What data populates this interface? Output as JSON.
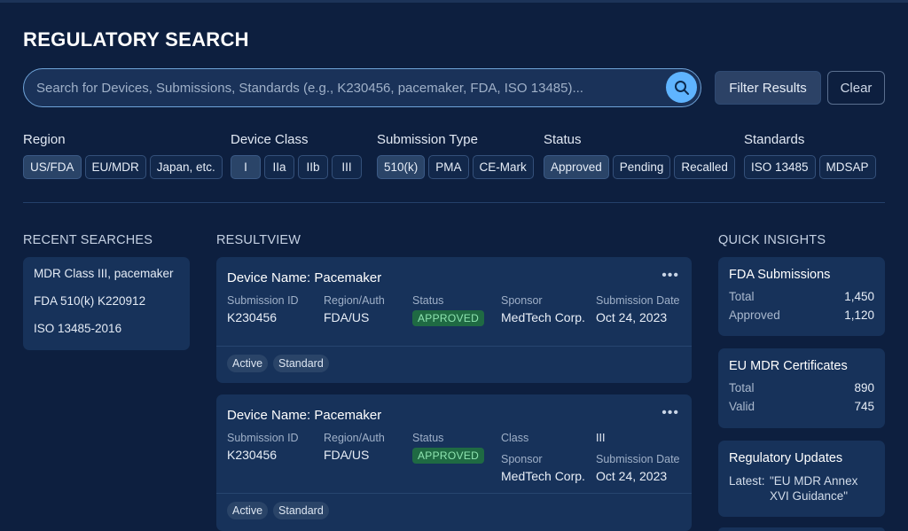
{
  "page_title": "REGULATORY SEARCH",
  "search": {
    "placeholder": "Search for Devices, Submissions, Standards (e.g., K230456, pacemaker, FDA, ISO 13485)..."
  },
  "buttons": {
    "filter": "Filter Results",
    "clear": "Clear"
  },
  "filters": {
    "region": {
      "label": "Region",
      "options": [
        "US/FDA",
        "EU/MDR",
        "Japan, etc."
      ]
    },
    "device_class": {
      "label": "Device Class",
      "options": [
        "I",
        "IIa",
        "IIb",
        "III"
      ]
    },
    "submission_type": {
      "label": "Submission Type",
      "options": [
        "510(k)",
        "PMA",
        "CE-Mark"
      ]
    },
    "status": {
      "label": "Status",
      "options": [
        "Approved",
        "Pending",
        "Recalled"
      ]
    },
    "standards": {
      "label": "Standards",
      "options": [
        "ISO 13485",
        "MDSAP"
      ]
    }
  },
  "recent": {
    "title": "RECENT SEARCHES",
    "items": [
      "MDR Class III, pacemaker",
      "FDA 510(k) K220912",
      "ISO 13485-2016"
    ]
  },
  "results": {
    "title": "RESULTVIEW",
    "cards": [
      {
        "name": "Device Name: Pacemaker",
        "submission_id_label": "Submission ID",
        "submission_id": "K230456",
        "region_label": "Region/Auth",
        "region": "FDA/US",
        "status_label": "Status",
        "status": "APPROVED",
        "sponsor_label": "Sponsor",
        "sponsor": "MedTech Corp.",
        "date_label": "Submission Date",
        "date": "Oct 24, 2023",
        "tags": [
          "Active",
          "Standard"
        ]
      },
      {
        "name": "Device Name: Pacemaker",
        "submission_id_label": "Submission ID",
        "submission_id": "K230456",
        "region_label": "Region/Auth",
        "region": "FDA/US",
        "status_label": "Status",
        "status": "APPROVED",
        "class_label": "Class",
        "class": "III",
        "sponsor_label": "Sponsor",
        "sponsor": "MedTech Corp.",
        "date_label": "Submission Date",
        "date": "Oct 24, 2023",
        "tags": [
          "Active",
          "Standard"
        ]
      }
    ]
  },
  "insights": {
    "title": "QUICK INSIGHTS",
    "fda": {
      "title": "FDA Submissions",
      "total_label": "Total",
      "total": "1,450",
      "approved_label": "Approved",
      "approved": "1,120"
    },
    "mdr": {
      "title": "EU MDR Certificates",
      "total_label": "Total",
      "total": "890",
      "valid_label": "Valid",
      "valid": "745"
    },
    "updates": {
      "title": "Regulatory Updates",
      "latest_label": "Latest:",
      "latest": "\"EU MDR Annex XVI Guidance\""
    }
  },
  "colors": {
    "background": "#0d1f3f",
    "panel": "#17325a",
    "accent": "#5fb4ff",
    "approved": "#1f6a43"
  },
  "icons": {
    "search": "search-icon",
    "more": "more-horizontal-icon"
  }
}
